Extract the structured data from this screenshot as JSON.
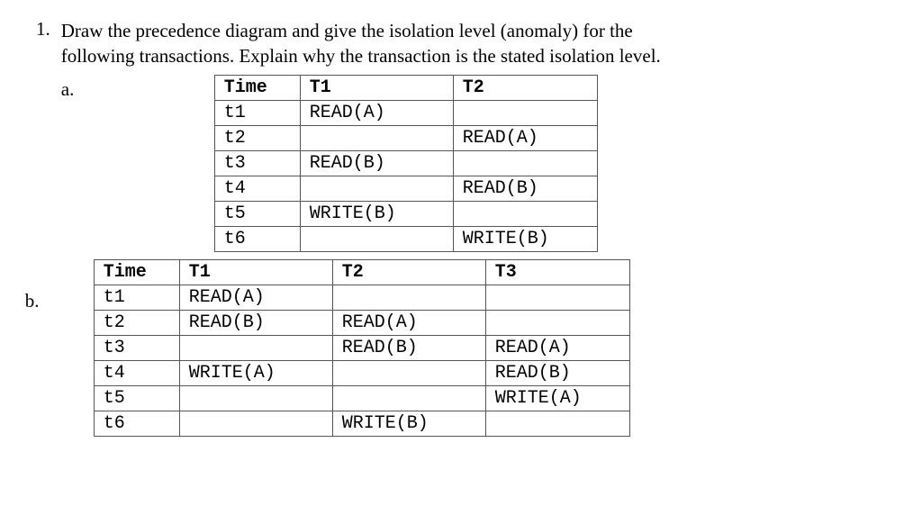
{
  "question": {
    "number": "1.",
    "text_line1": "Draw the precedence diagram and give the isolation level (anomaly) for the",
    "text_line2": "following transactions. Explain why the transaction is the stated isolation level."
  },
  "part_a": {
    "label": "a.",
    "headers": {
      "time": "Time",
      "t1": "T1",
      "t2": "T2"
    },
    "rows": [
      {
        "time": "t1",
        "t1": "READ(A)",
        "t2": ""
      },
      {
        "time": "t2",
        "t1": "",
        "t2": "READ(A)"
      },
      {
        "time": "t3",
        "t1": "READ(B)",
        "t2": ""
      },
      {
        "time": "t4",
        "t1": "",
        "t2": "READ(B)"
      },
      {
        "time": "t5",
        "t1": "WRITE(B)",
        "t2": ""
      },
      {
        "time": "t6",
        "t1": "",
        "t2": "WRITE(B)"
      }
    ]
  },
  "part_b": {
    "label": "b.",
    "headers": {
      "time": "Time",
      "t1": "T1",
      "t2": "T2",
      "t3": "T3"
    },
    "rows": [
      {
        "time": "t1",
        "t1": "READ(A)",
        "t2": "",
        "t3": ""
      },
      {
        "time": "t2",
        "t1": "READ(B)",
        "t2": "READ(A)",
        "t3": ""
      },
      {
        "time": "t3",
        "t1": "",
        "t2": "READ(B)",
        "t3": "READ(A)"
      },
      {
        "time": "t4",
        "t1": "WRITE(A)",
        "t2": "",
        "t3": "READ(B)"
      },
      {
        "time": "t5",
        "t1": "",
        "t2": "",
        "t3": "WRITE(A)"
      },
      {
        "time": "t6",
        "t1": "",
        "t2": "WRITE(B)",
        "t3": ""
      }
    ]
  }
}
